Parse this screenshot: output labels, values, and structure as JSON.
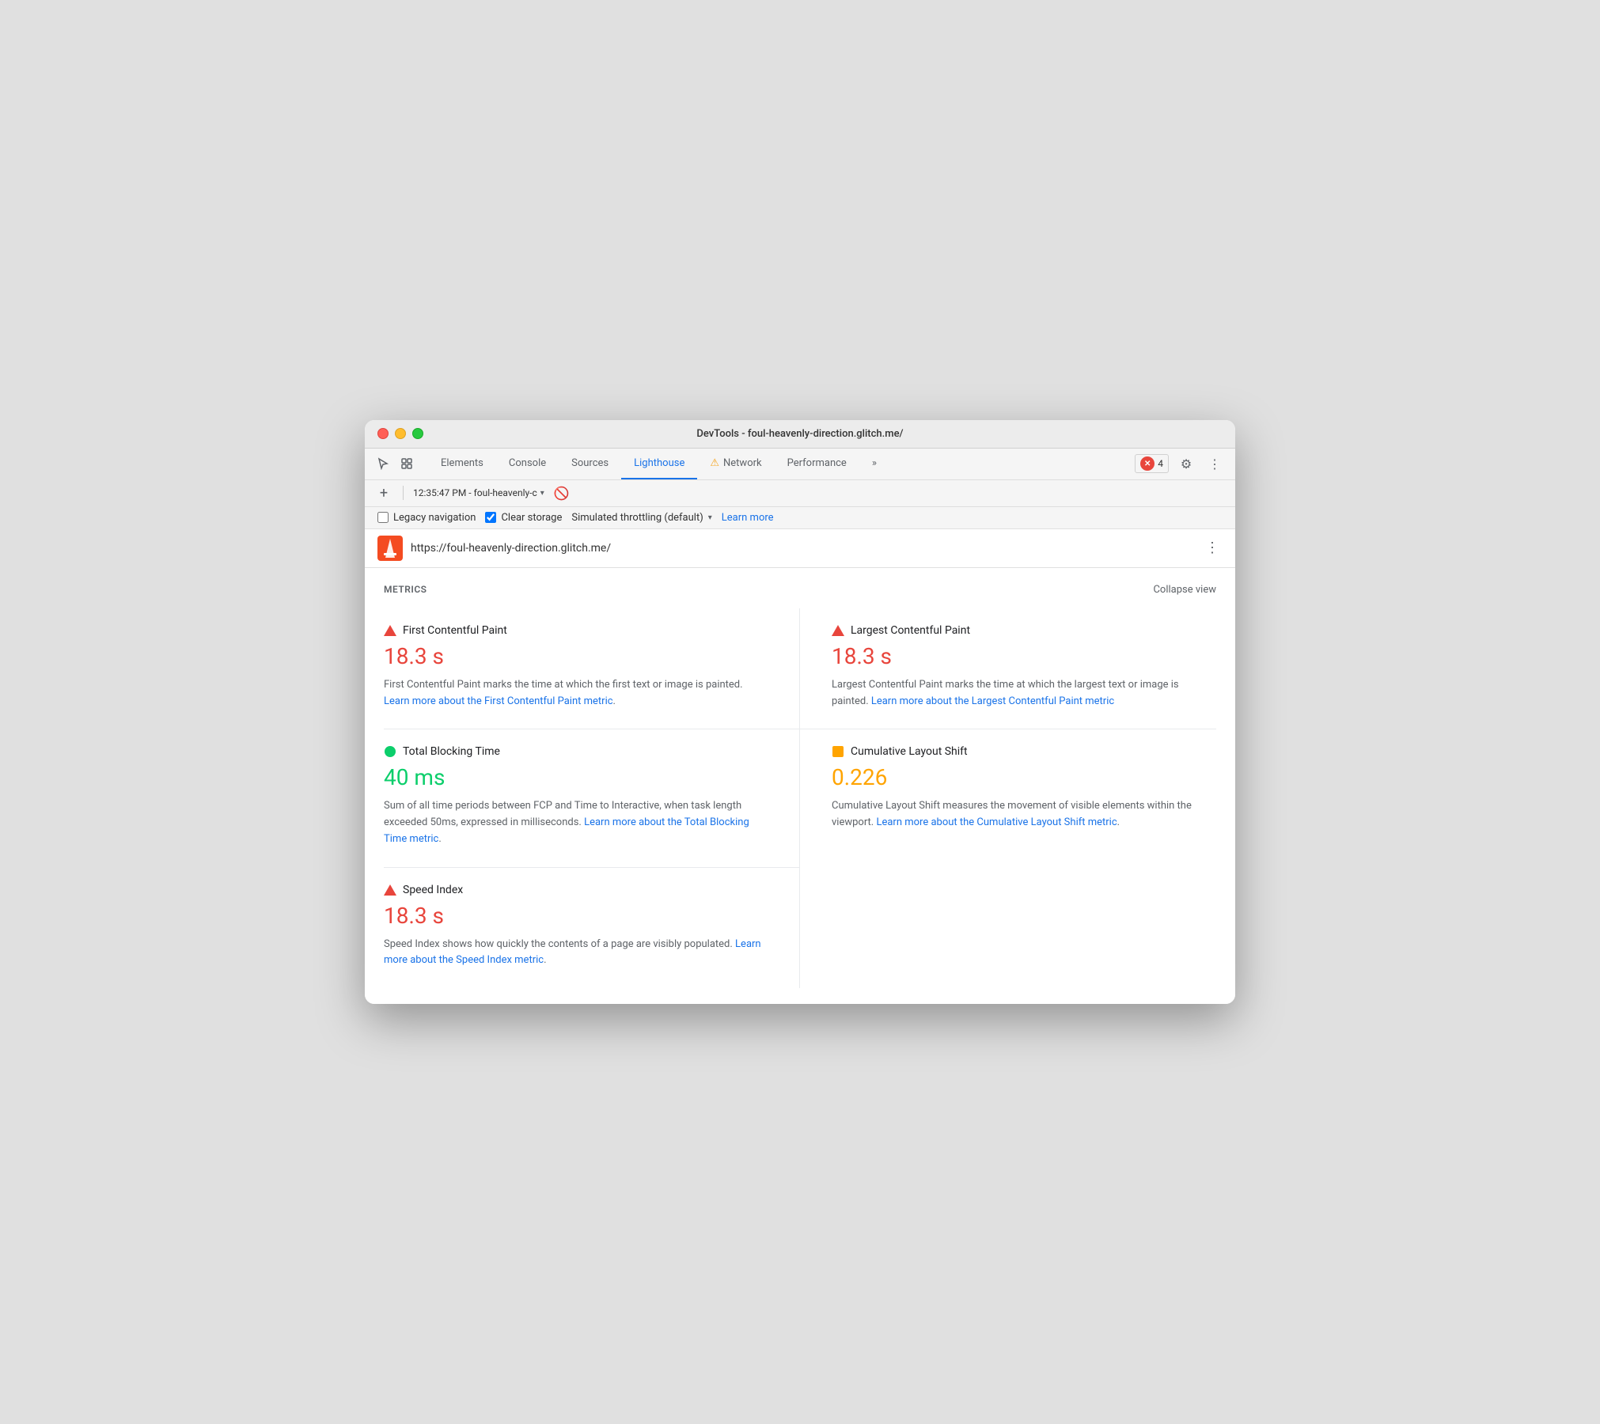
{
  "window": {
    "title": "DevTools - foul-heavenly-direction.glitch.me/"
  },
  "tabs": {
    "elements": "Elements",
    "console": "Console",
    "sources": "Sources",
    "lighthouse": "Lighthouse",
    "network": "Network",
    "performance": "Performance",
    "more": "»"
  },
  "toolbar": {
    "timestamp": "12:35:47 PM - foul-heavenly-c",
    "error_count": "4"
  },
  "options": {
    "legacy_navigation_label": "Legacy navigation",
    "clear_storage_label": "Clear storage",
    "throttling_label": "Simulated throttling (default)",
    "learn_more_label": "Learn more"
  },
  "url_bar": {
    "url": "https://foul-heavenly-direction.glitch.me/"
  },
  "metrics": {
    "title": "METRICS",
    "collapse_label": "Collapse view",
    "items": [
      {
        "name": "First Contentful Paint",
        "value": "18.3 s",
        "value_type": "red",
        "indicator": "triangle-red",
        "description": "First Contentful Paint marks the time at which the first text or image is painted.",
        "link_text": "Learn more about the First Contentful Paint metric",
        "link_href": "#"
      },
      {
        "name": "Largest Contentful Paint",
        "value": "18.3 s",
        "value_type": "red",
        "indicator": "triangle-red",
        "description": "Largest Contentful Paint marks the time at which the largest text or image is painted.",
        "link_text": "Learn more about the Largest Contentful Paint metric",
        "link_href": "#"
      },
      {
        "name": "Total Blocking Time",
        "value": "40 ms",
        "value_type": "green",
        "indicator": "circle-green",
        "description": "Sum of all time periods between FCP and Time to Interactive, when task length exceeded 50ms, expressed in milliseconds.",
        "link_text": "Learn more about the Total Blocking Time metric",
        "link_href": "#"
      },
      {
        "name": "Cumulative Layout Shift",
        "value": "0.226",
        "value_type": "orange",
        "indicator": "square-orange",
        "description": "Cumulative Layout Shift measures the movement of visible elements within the viewport.",
        "link_text": "Learn more about the Cumulative Layout Shift metric",
        "link_href": "#"
      },
      {
        "name": "Speed Index",
        "value": "18.3 s",
        "value_type": "red",
        "indicator": "triangle-red",
        "description": "Speed Index shows how quickly the contents of a page are visibly populated.",
        "link_text": "Learn more about the Speed Index metric",
        "link_href": "#"
      }
    ]
  }
}
